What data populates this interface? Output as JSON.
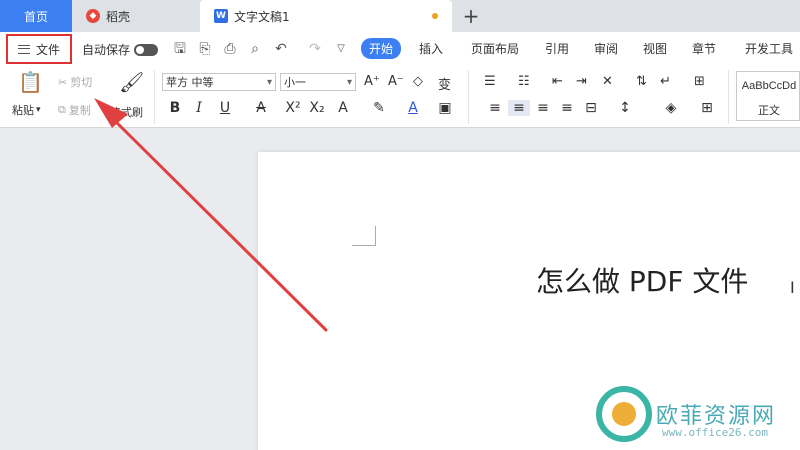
{
  "tabs": {
    "home": "首页",
    "docer": "稻壳",
    "document": "文字文稿1",
    "add": "+"
  },
  "menu": {
    "file": "文件",
    "autosave": "自动保存",
    "tabs": [
      "开始",
      "插入",
      "页面布局",
      "引用",
      "审阅",
      "视图",
      "章节",
      "开发工具"
    ]
  },
  "ribbon": {
    "paste": "粘贴",
    "cut": "剪切",
    "copy": "复制",
    "format_painter": "格式刷",
    "font_name": "苹方 中等",
    "font_size": "小一",
    "style_sample": "AaBbCcDd",
    "style_name": "正文"
  },
  "document": {
    "title": "怎么做 PDF 文件"
  },
  "watermark": {
    "name": "欧菲资源网",
    "url": "www.office26.com"
  },
  "colors": {
    "accent": "#3b7ff3",
    "highlight_box": "#dd3333",
    "arrow": "#e04040"
  }
}
